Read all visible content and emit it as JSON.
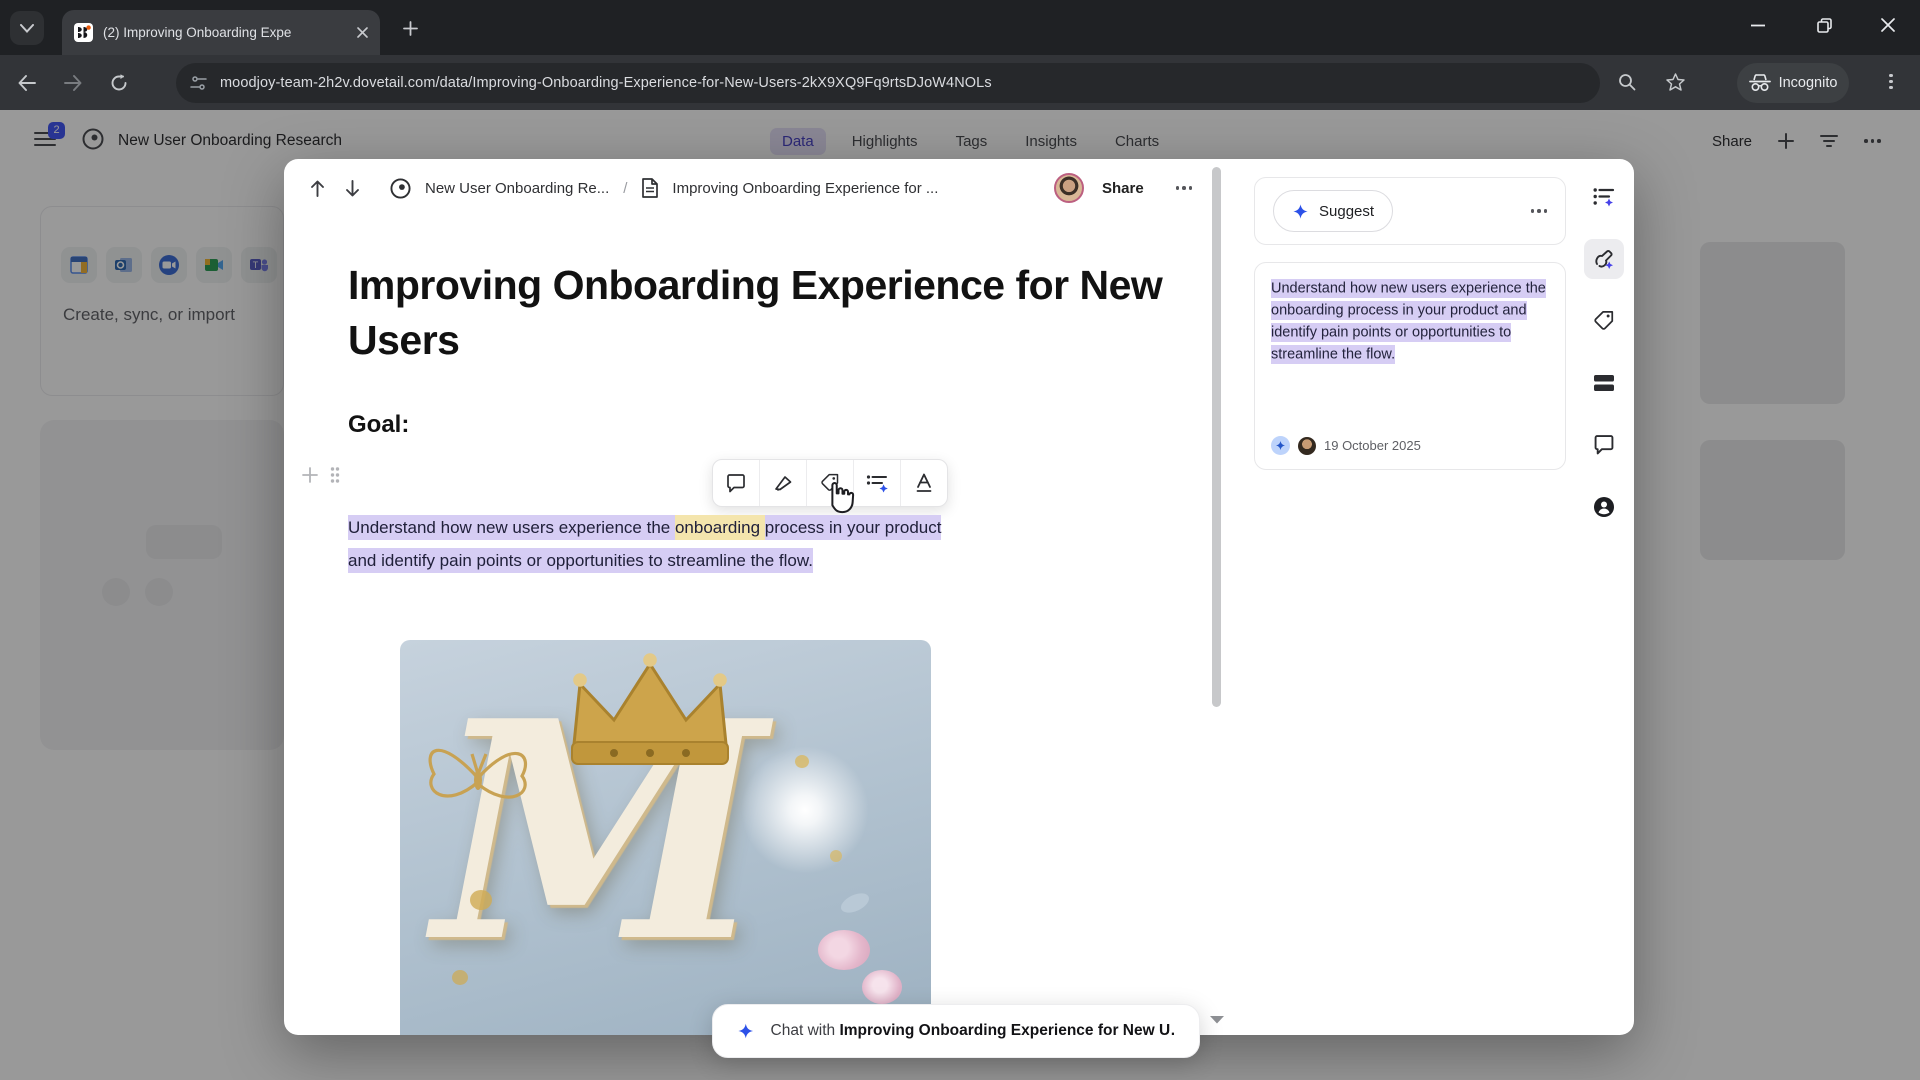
{
  "browser": {
    "tab_title": "(2) Improving Onboarding Expe",
    "url": "moodjoy-team-2h2v.dovetail.com/data/Improving-Onboarding-Experience-for-New-Users-2kX9XQ9Fq9rtsDJoW4NOLs",
    "incognito_label": "Incognito"
  },
  "page": {
    "badge_count": "2",
    "project_title": "New User Onboarding Research",
    "tabs": [
      {
        "label": "Data",
        "active": true
      },
      {
        "label": "Highlights",
        "active": false
      },
      {
        "label": "Tags",
        "active": false
      },
      {
        "label": "Insights",
        "active": false
      },
      {
        "label": "Charts",
        "active": false
      }
    ],
    "share_label": "Share",
    "create_sync_label": "Create, sync, or import",
    "integration_icons": [
      "window-icon",
      "outlook-icon",
      "zoom-icon",
      "meet-icon",
      "teams-icon"
    ]
  },
  "modal": {
    "breadcrumb": {
      "project": "New User Onboarding Re...",
      "separator": "/",
      "document": "Improving Onboarding Experience for ..."
    },
    "share_label": "Share",
    "document": {
      "title": "Improving Onboarding Experience for New Users",
      "heading": "Goal:",
      "paragraph_pre": "Understand how new users experience the ",
      "paragraph_highlight_yellow": "onboarding ",
      "paragraph_post": "process in your product and identify pain points or opportunities to streamline the flow.",
      "image_letter": "M"
    },
    "format_toolbar_icons": [
      "comment-icon",
      "highlighter-icon",
      "tag-icon",
      "fields-sparkle-icon",
      "text-style-icon"
    ],
    "panel": {
      "suggest_label": "Suggest",
      "highlight_text": "Understand how new users experience the onboarding process in your product and identify pain points or opportunities to streamline the flow.",
      "date": "19 October 2025"
    },
    "rail_icons": [
      "summary-sparkle-icon",
      "highlight-pen-sparkle-icon",
      "tag-icon",
      "fields-icon",
      "comment-icon",
      "person-icon"
    ],
    "chat": {
      "prefix": "Chat with ",
      "document_bold": "Improving Onboarding Experience for New U…"
    }
  },
  "colors": {
    "accent_blue": "#2c51e8",
    "accent_indigo": "#4a43c6",
    "highlight_purple": "#d6cdf4",
    "highlight_yellow": "#f4e5ad",
    "chrome_dark": "#1f2124",
    "toolbar_dark": "#323438"
  }
}
